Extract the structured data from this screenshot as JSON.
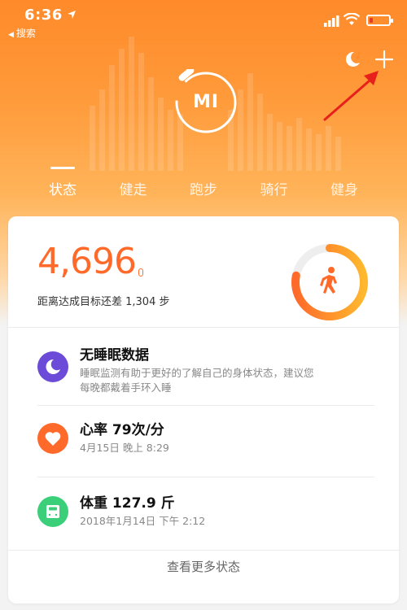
{
  "status_bar": {
    "time": "6:36",
    "back_label": "搜索"
  },
  "colors": {
    "accent": "#ff7a2a",
    "sleep": "#6b4bd8",
    "heart": "#ff6a2a",
    "weight": "#3ccf7a",
    "arrow": "#e8201c"
  },
  "header": {
    "logo_text": "MI"
  },
  "tabs": [
    {
      "label": "状态",
      "active": true
    },
    {
      "label": "健走",
      "active": false
    },
    {
      "label": "跑步",
      "active": false
    },
    {
      "label": "骑行",
      "active": false
    },
    {
      "label": "健身",
      "active": false
    }
  ],
  "steps": {
    "value": "4,696",
    "goal_text": "距离达成目标还差 1,304 步",
    "progress": 0.78
  },
  "items": [
    {
      "title": "无睡眠数据",
      "subtitle_line1": "睡眠监测有助于更好的了解自己的身体状态，建议您",
      "subtitle_line2": "每晚都戴着手环入睡",
      "icon": "moon-icon"
    },
    {
      "title": "心率 79次/分",
      "subtitle": "4月15日 晚上 8:29",
      "icon": "heart-icon"
    },
    {
      "title": "体重 127.9 斤",
      "subtitle": "2018年1月14日 下午 2:12",
      "icon": "scale-icon"
    }
  ],
  "more_link": "查看更多状态"
}
